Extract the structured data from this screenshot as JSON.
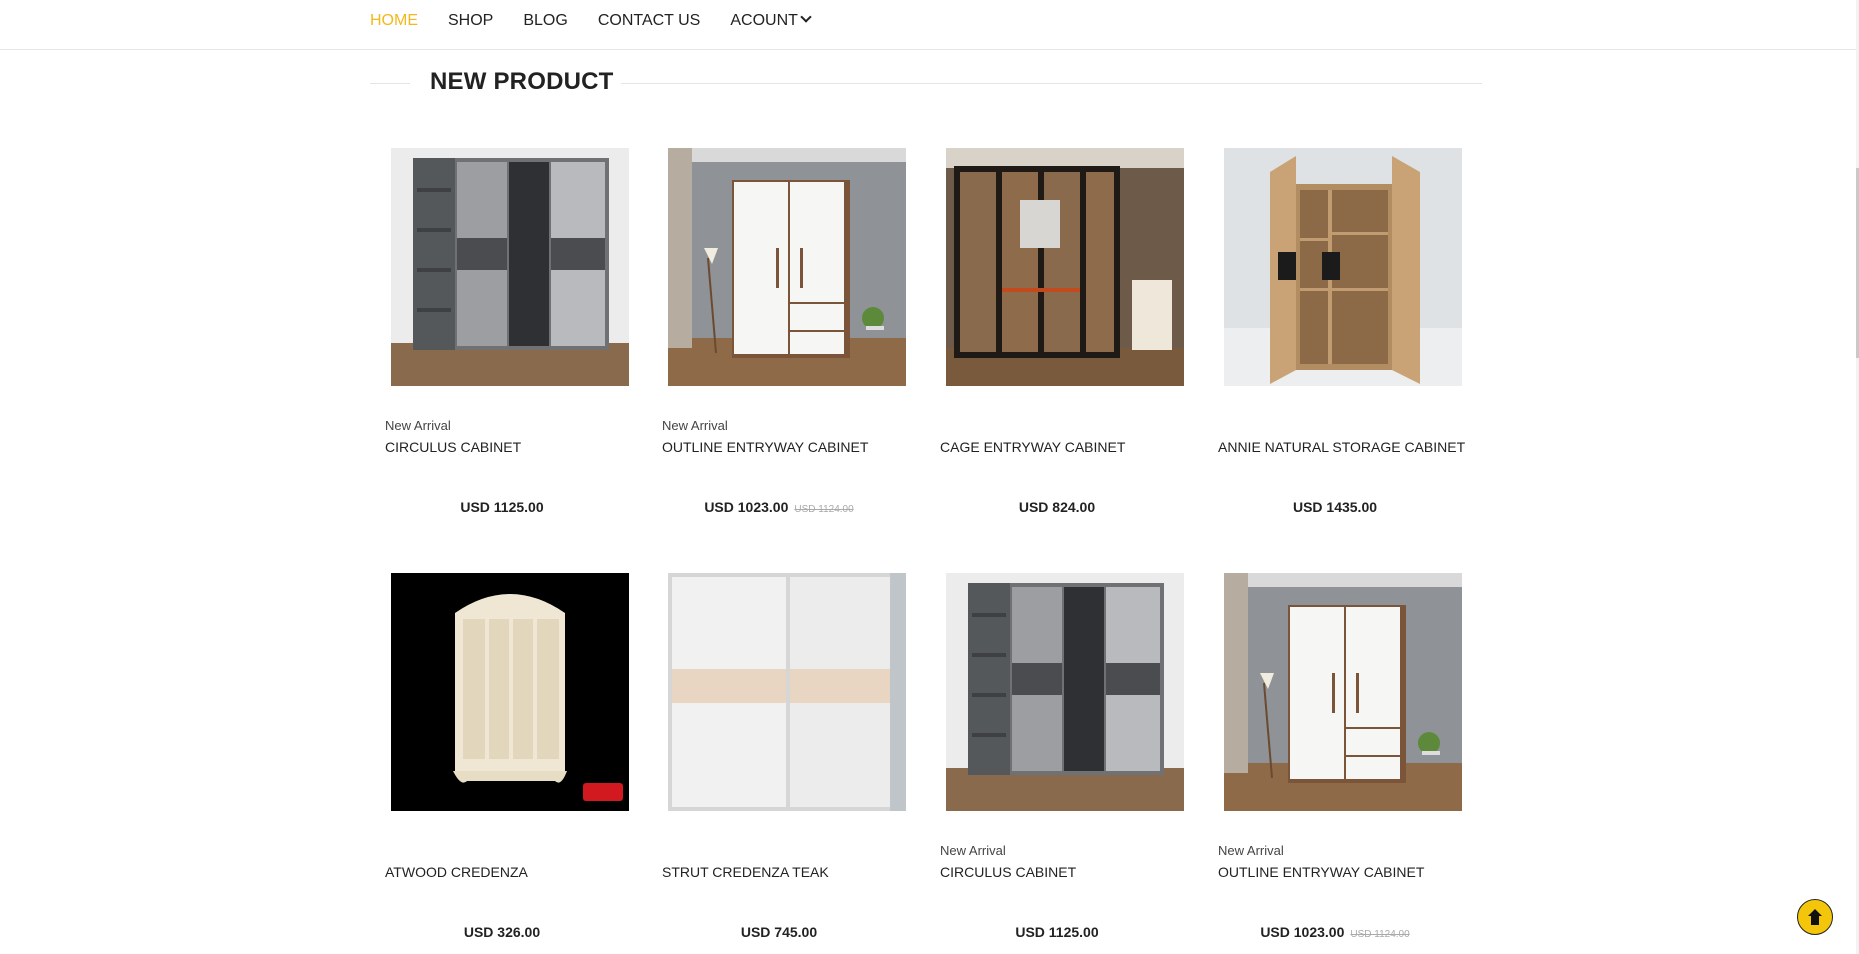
{
  "nav": {
    "items": [
      {
        "label": "HOME",
        "active": true
      },
      {
        "label": "SHOP",
        "active": false
      },
      {
        "label": "BLOG",
        "active": false
      },
      {
        "label": "CONTACT US",
        "active": false
      },
      {
        "label": "ACOUNT",
        "active": false,
        "dropdown": true
      }
    ]
  },
  "section": {
    "title": "NEW PRODUCT"
  },
  "products": [
    {
      "badge": "New Arrival",
      "name": "CIRCULUS CABINET",
      "price": "USD 1125.00",
      "old_price": "",
      "image_icon": "grey-sliding-wardrobe-image"
    },
    {
      "badge": "New Arrival",
      "name": "OUTLINE ENTRYWAY CABINET",
      "price": "USD 1023.00",
      "old_price": "USD 1124.00",
      "image_icon": "white-wood-cabinet-image"
    },
    {
      "badge": "",
      "name": "CAGE ENTRYWAY CABINET",
      "price": "USD 824.00",
      "old_price": "",
      "image_icon": "glass-door-wardrobe-image"
    },
    {
      "badge": "",
      "name": "ANNIE NATURAL STORAGE CABINET",
      "price": "USD 1435.00",
      "old_price": "",
      "image_icon": "open-wood-cabinet-image"
    },
    {
      "badge": "",
      "name": "ATWOOD CREDENZA",
      "price": "USD 326.00",
      "old_price": "",
      "image_icon": "ornate-white-wardrobe-image"
    },
    {
      "badge": "",
      "name": "STRUT CREDENZA TEAK",
      "price": "USD 745.00",
      "old_price": "",
      "image_icon": "white-sliding-wardrobe-image"
    },
    {
      "badge": "New Arrival",
      "name": "CIRCULUS CABINET",
      "price": "USD 1125.00",
      "old_price": "",
      "image_icon": "grey-sliding-wardrobe-image"
    },
    {
      "badge": "New Arrival",
      "name": "OUTLINE ENTRYWAY CABINET",
      "price": "USD 1023.00",
      "old_price": "USD 1124.00",
      "image_icon": "white-wood-cabinet-image"
    }
  ],
  "colors": {
    "accent": "#f3b81b",
    "back_to_top": "#f3c60b"
  }
}
